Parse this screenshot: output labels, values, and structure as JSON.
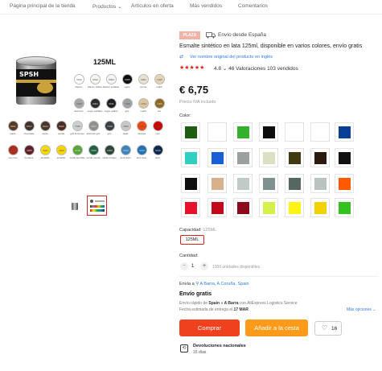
{
  "nav": {
    "items": [
      "Página principal de la tienda",
      "Productos",
      "Artículos en oferta",
      "Más vendidos",
      "Comentarios"
    ],
    "products_caret": "⌄"
  },
  "gallery": {
    "size_label": "125ML",
    "can_brand": "SPSH",
    "swatch_rows": [
      [
        {
          "code": "9010",
          "name": "blanco",
          "color": "#ffffff"
        },
        {
          "code": "9016",
          "name": "blanco tráfico",
          "color": "#f6f6f0"
        },
        {
          "code": "9003",
          "name": "blanco señales",
          "color": "#f4f4f4"
        },
        {
          "code": "9005",
          "name": "negro",
          "color": "#0e0e10"
        },
        {
          "code": "9001",
          "name": "crema",
          "color": "#e9e0d2"
        },
        {
          "code": "1015",
          "name": "marfil",
          "color": "#e6d2b5"
        }
      ],
      [
        {
          "code": "9006",
          "name": "aluminio",
          "color": "#a5a8a6"
        },
        {
          "code": "9004",
          "name": "negro señales",
          "color": "#2b2b2c"
        },
        {
          "code": "9011",
          "name": "negro grafito",
          "color": "#1c1e21"
        },
        {
          "code": "7040",
          "name": "gris",
          "color": "#9da3a6"
        },
        {
          "code": "1014",
          "name": "marfil",
          "color": "#ddc49a"
        },
        {
          "code": "1036",
          "name": "oro",
          "color": "#8a6a22"
        }
      ],
      [
        {
          "code": "8011",
          "name": "pardo",
          "color": "#5a3826"
        },
        {
          "code": "8017",
          "name": "chocolate",
          "color": "#44322d"
        },
        {
          "code": "8014",
          "name": "sepia",
          "color": "#4a3526"
        },
        {
          "code": "8016",
          "name": "caoba",
          "color": "#4c2b20"
        },
        {
          "code": "7035",
          "name": "gris luminoso",
          "color": "#cbd0cc"
        },
        {
          "code": "9007",
          "name": "aluminio gris",
          "color": "#8f8f8c"
        },
        {
          "code": "7016",
          "name": "gris",
          "color": "#383e42"
        },
        {
          "code": "9006",
          "name": "plata",
          "color": "#c8c9c7"
        },
        {
          "code": "2004",
          "name": "naranja",
          "color": "#f44611"
        },
        {
          "code": "3020",
          "name": "rojo",
          "color": "#cc0605"
        }
      ],
      [
        {
          "code": "3000",
          "name": "rojo vivo",
          "color": "#af2b1e"
        },
        {
          "code": "3005",
          "name": "burdeos",
          "color": "#5e2129"
        },
        {
          "code": "1021",
          "name": "amarillo",
          "color": "#f3da0b"
        },
        {
          "code": "1023",
          "name": "amarillo",
          "color": "#fad201"
        },
        {
          "code": "6018",
          "name": "verde amarillo",
          "color": "#57a639"
        },
        {
          "code": "6029",
          "name": "verde menta",
          "color": "#20603d"
        },
        {
          "code": "6005",
          "name": "verde musgo",
          "color": "#2f4538"
        },
        {
          "code": "5012",
          "name": "azul claro",
          "color": "#3b83bd"
        },
        {
          "code": "5015",
          "name": "azul cielo",
          "color": "#2271b3"
        },
        {
          "code": "5010",
          "name": "azul",
          "color": "#0e294b"
        }
      ]
    ]
  },
  "product": {
    "badge": "PLAZA",
    "ships_from": "Envío desde España",
    "title": "Esmalte sintético en lata 125ml, disponible en varios colores, envío gratis",
    "translate_link": "Ver nombre original del producto en inglés",
    "stars": "★★★★★",
    "rating": "4.8",
    "reviews": "46 Valoraciones",
    "sold": "103 vendidos",
    "price": "€ 6,75",
    "vat": "Precio IVA incluido",
    "color_label": "Color:",
    "colors": [
      [
        "#1e5e10",
        "#ffffff",
        "#33b12c",
        "#0d0d0d",
        "#ffffff",
        "#ffffff",
        "#0a3f96"
      ],
      [
        "#2fd0c2",
        "#1a5fd6",
        "#9aa09c",
        "#dcdfc2",
        "#3f3a10",
        "#2a1a10",
        "#111111"
      ],
      [
        "#0f0f0f",
        "#d9b08c",
        "#c0cac6",
        "#7f9090",
        "#566763",
        "#b9c4c1",
        "#ff5a00"
      ],
      [
        "#e5132a",
        "#c20a1c",
        "#8a0b1e",
        "#d5f04a",
        "#fff314",
        "#f2d200",
        "#34c21e"
      ]
    ],
    "capacity_label": "Capacidad:",
    "capacity_value": "125ML",
    "capacity_option": "125ML",
    "quantity_label": "Cantidad:",
    "quantity": "1",
    "stock": "1000 unidades disponibles",
    "send_to_label": "Envía a",
    "send_to_location": "A Barra, A Coruña, Spain",
    "free_shipping": "Envío gratis",
    "ship_detail_pre": "Envío rápido de",
    "ship_from": "Spain",
    "ship_detail_mid": "a",
    "ship_to": "A Barra",
    "ship_detail_post": "con AliExpress Logistics Service",
    "ship_date_pre": "Fecha estimada de entrega el",
    "ship_date": "17 MAR",
    "more_options": "Más opciones",
    "buy_label": "Comprar",
    "cart_label": "Añadir a la cesta",
    "wish_count": "16",
    "returns_title": "Devoluciones nacionales",
    "returns_sub": "15 días"
  }
}
